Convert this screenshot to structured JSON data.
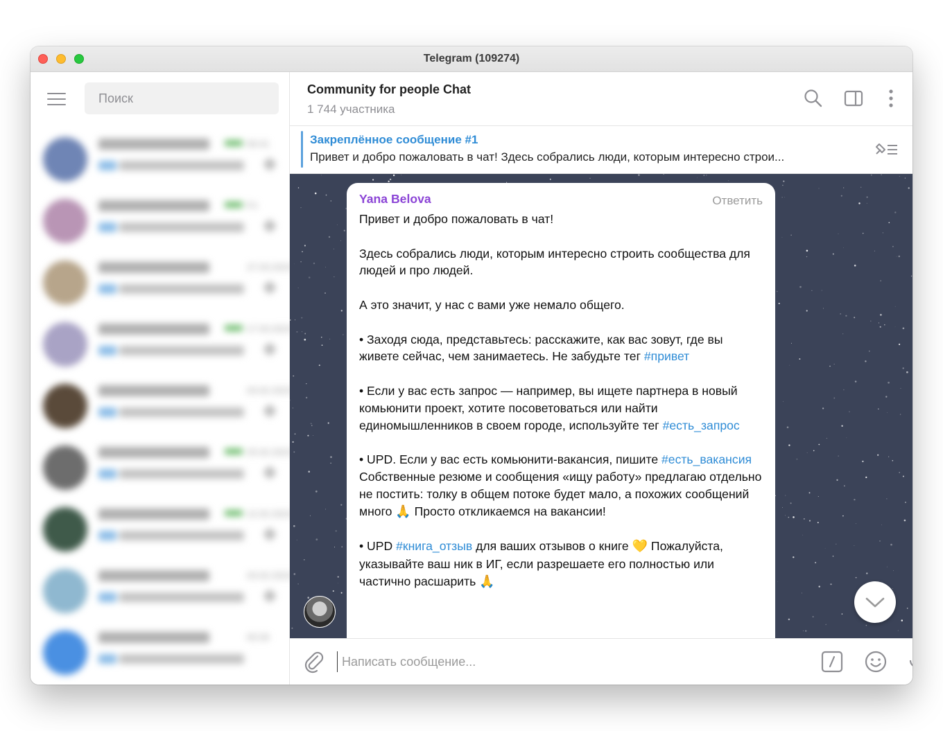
{
  "window": {
    "title": "Telegram (109274)"
  },
  "sidebar": {
    "search_placeholder": "Поиск",
    "chats": [
      {
        "avatar_color": "#6f85b5",
        "time": "06:41",
        "read": true
      },
      {
        "avatar_color": "#b995b5",
        "time": "Fri",
        "read": true
      },
      {
        "avatar_color": "#b7a58b",
        "time": "27.03.2023",
        "read": false
      },
      {
        "avatar_color": "#a9a3c5",
        "time": "17.03.2023",
        "read": true
      },
      {
        "avatar_color": "#5a4a3a",
        "time": "03.02.2023",
        "read": false
      },
      {
        "avatar_color": "#6d6d6d",
        "time": "25.02.2023",
        "read": true
      },
      {
        "avatar_color": "#3f5a4a",
        "time": "12.02.2023",
        "read": true
      },
      {
        "avatar_color": "#8fb8d0",
        "time": "03.02.2023",
        "read": false
      },
      {
        "avatar_color": "#4a90e2",
        "time": "00:26",
        "read": false
      }
    ]
  },
  "chat": {
    "title": "Community for people Chat",
    "subtitle": "1 744 участника",
    "pinned": {
      "title": "Закреплённое сообщение #1",
      "text": "Привет и добро пожаловать в чат!  Здесь собрались люди, которым интересно строи..."
    },
    "message": {
      "sender": "Yana Belova",
      "reply_label": "Ответить",
      "p1": "Привет и добро пожаловать в чат!",
      "p2": "Здесь собрались люди, которым интересно строить сообщества для людей и про людей.",
      "p3": "А это значит, у нас с вами уже немало общего.",
      "p4_text": "• Заходя сюда, представьтесь: расскажите, как вас зовут, где вы живете сейчас, чем занимаетесь. Не забудьте тег ",
      "p4_tag": "#привет",
      "p5_text": "• Если у вас есть запрос — например, вы ищете партнера в новый комьюнити проект, хотите посоветоваться или найти единомышленников в своем городе, используйте тег ",
      "p5_tag": "#есть_запрос",
      "p6_a": "• UPD. Если у вас есть комьюнити-вакансия, пишите ",
      "p6_tag": "#есть_вакансия",
      "p6_b": " Собственные резюме и сообщения «ищу работу» предлагаю отдельно не постить: толку в общем потоке будет мало, а похожих сообщений много ",
      "p6_emoji": "🙏",
      "p6_c": " Просто откликаемся на вакансии!",
      "p7_a": "• UPD ",
      "p7_tag": "#книга_отзыв",
      "p7_b": " для ваших отзывов о книге ",
      "p7_emoji1": "💛",
      "p7_c": " Пожалуйста, указывайте ваш ник в ИГ, если разрешаете его полностью или частично расшарить ",
      "p7_emoji2": "🙏"
    },
    "composer_placeholder": "Написать сообщение..."
  },
  "colors": {
    "accent": "#2f8cd6",
    "sender": "#8b44d6",
    "chat_bg": "#3a4257"
  },
  "icons": [
    "menu-icon",
    "search-icon",
    "sidebar-toggle-icon",
    "more-icon",
    "pin-list-icon",
    "attach-icon",
    "commands-icon",
    "emoji-icon",
    "microphone-icon",
    "chevron-down-icon"
  ]
}
